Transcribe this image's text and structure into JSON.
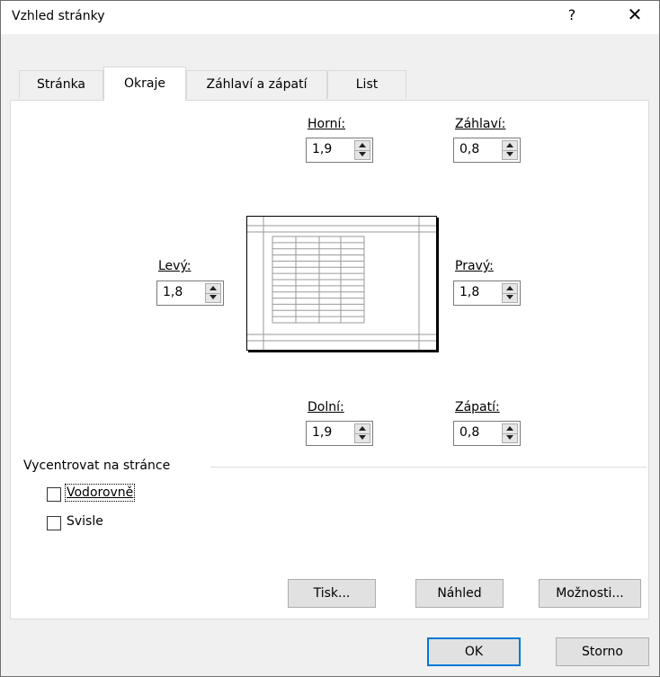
{
  "title": "Vzhled stránky",
  "controls": {
    "help": "?",
    "close": "✕"
  },
  "tabs": [
    "Stránka",
    "Okraje",
    "Záhlaví a zápatí",
    "List"
  ],
  "margins": {
    "top": {
      "label": "Horní:",
      "value": "1,9"
    },
    "header": {
      "label": "Záhlaví:",
      "value": "0,8"
    },
    "left": {
      "label": "Levý:",
      "value": "1,8"
    },
    "right": {
      "label": "Pravý:",
      "value": "1,8"
    },
    "bottom": {
      "label": "Dolní:",
      "value": "1,9"
    },
    "footer": {
      "label": "Zápatí:",
      "value": "0,8"
    }
  },
  "center": {
    "group_label": "Vycentrovat na stránce",
    "horizontal": {
      "label": "Vodorovně",
      "checked": false
    },
    "vertical": {
      "label": "Svisle",
      "checked": false
    }
  },
  "buttons": {
    "print": "Tisk...",
    "preview": "Náhled",
    "options": "Možnosti...",
    "ok": "OK",
    "cancel": "Storno"
  },
  "colors": {
    "accent": "#0078d7",
    "face": "#f0f0f0"
  }
}
